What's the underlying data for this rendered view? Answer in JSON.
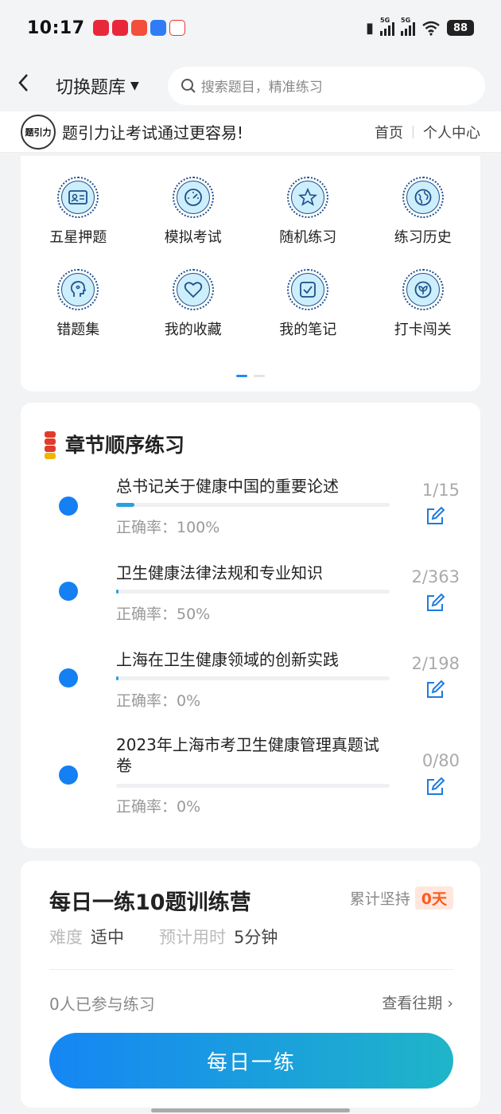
{
  "status_bar": {
    "time": "10:17",
    "network1": "5G",
    "network2": "5G",
    "battery": "88"
  },
  "header": {
    "switch_label": "切换题库",
    "search_placeholder": "搜索题目，精准练习"
  },
  "slogan": {
    "text": "题引力让考试通过更容易!",
    "nav_home": "首页",
    "nav_user": "个人中心"
  },
  "tools": [
    {
      "label": "五星押题",
      "icon": "id-card-icon"
    },
    {
      "label": "模拟考试",
      "icon": "gauge-icon"
    },
    {
      "label": "随机练习",
      "icon": "star-icon"
    },
    {
      "label": "练习历史",
      "icon": "globe-icon"
    },
    {
      "label": "错题集",
      "icon": "brain-icon"
    },
    {
      "label": "我的收藏",
      "icon": "heart-icon"
    },
    {
      "label": "我的笔记",
      "icon": "note-check-icon"
    },
    {
      "label": "打卡闯关",
      "icon": "leaf-icon"
    }
  ],
  "chapters": {
    "title": "章节顺序练习",
    "items": [
      {
        "name": "总书记关于健康中国的重要论述",
        "accuracy": "正确率：100%",
        "count": "1/15",
        "progress": 0.0667
      },
      {
        "name": "卫生健康法律法规和专业知识",
        "accuracy": "正确率：50%",
        "count": "2/363",
        "progress": 0.0055
      },
      {
        "name": "上海在卫生健康领域的创新实践",
        "accuracy": "正确率：0%",
        "count": "2/198",
        "progress": 0.0101
      },
      {
        "name": "2023年上海市考卫生健康管理真题试卷",
        "accuracy": "正确率：0%",
        "count": "0/80",
        "progress": 0
      }
    ]
  },
  "training": {
    "title": "每日一练10题训练营",
    "streak_label": "累计坚持",
    "streak_value": "0天",
    "difficulty_label": "难度",
    "difficulty_value": "适中",
    "time_label": "预计用时",
    "time_value": "5分钟",
    "participants": "0人已参与练习",
    "history_link": "查看往期 ›",
    "button": "每日一练"
  },
  "colors": {
    "primary": "#1480f3",
    "accent_orange": "#ff5a1f",
    "icon_bg": "#cdeefb"
  }
}
